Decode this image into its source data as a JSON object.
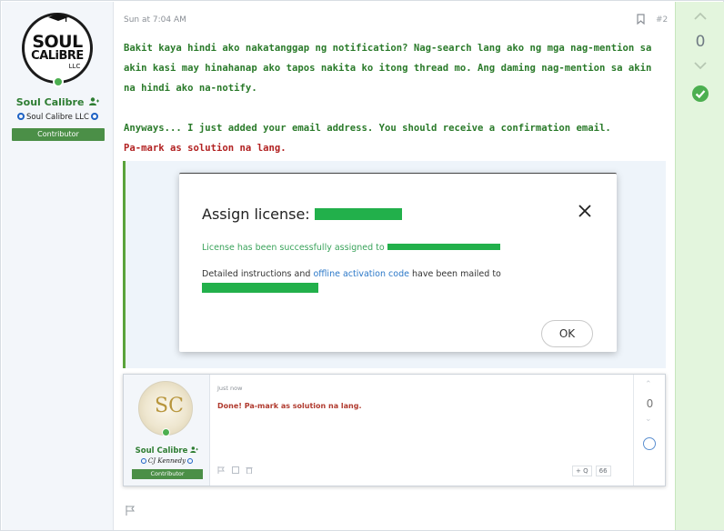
{
  "author": {
    "avatar_text_line1": "SOUL",
    "avatar_text_line2": "CALiBRE",
    "avatar_text_line3": "LLC",
    "name": "Soul Calibre",
    "organization": "Soul Calibre LLC",
    "role": "Contributor"
  },
  "post": {
    "timestamp": "Sun at 7:04 AM",
    "number": "#2",
    "paragraph1": "Bakit kaya hindi ako nakatanggap ng notification? Nag-search lang ako ng mga nag-mention sa akin kasi may hinahanap ako tapos nakita ko itong thread mo. Ang daming nag-mention sa akin na hindi ako na-notify.",
    "paragraph2": "Anyways... I just added your email address. You should receive a confirmation email.",
    "paragraph3": "Pa-mark as solution na lang."
  },
  "dialog": {
    "title": "Assign license:",
    "success_text": "License has been successfully assigned to",
    "instr_prefix": "Detailed instructions and",
    "instr_link": "offline activation code",
    "instr_suffix": "have been mailed to",
    "ok_label": "OK"
  },
  "reply": {
    "time": "Just now",
    "text": "Done! Pa-mark as solution na lang.",
    "author_name": "Soul Calibre",
    "author_org": "CJ Kennedy",
    "author_role": "Contributor",
    "vote_count": "0",
    "quote_label": "+ Q",
    "action_label": "66"
  },
  "votes": {
    "count": "0"
  },
  "colors": {
    "accent_green": "#2a7a2a",
    "solution_green": "#4caf50",
    "mark_red": "#b22222",
    "redaction_green": "#22b04b"
  }
}
